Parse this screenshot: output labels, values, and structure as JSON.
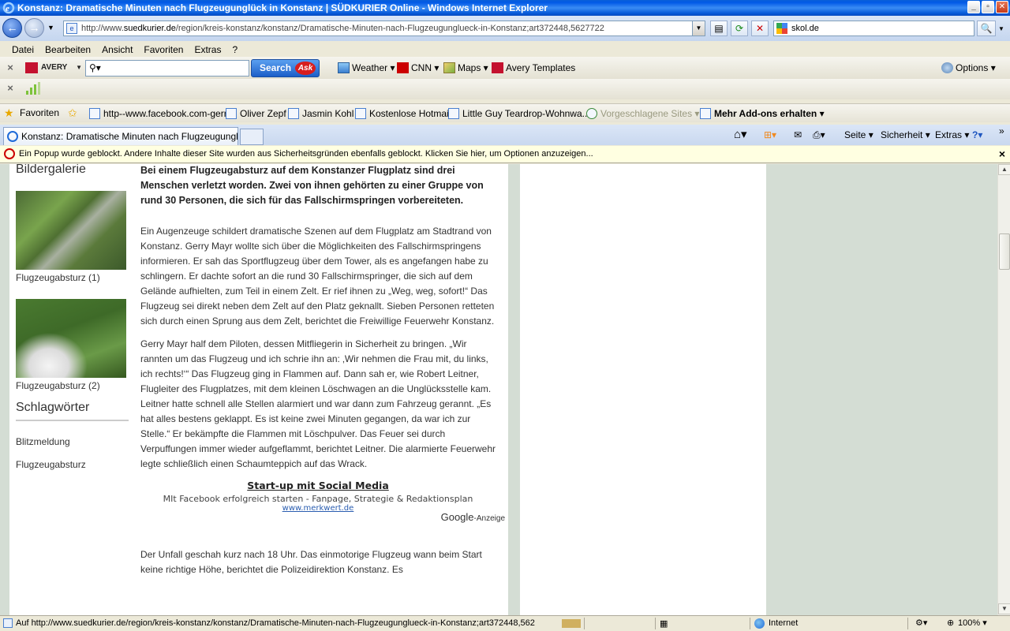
{
  "window": {
    "title": "Konstanz: Dramatische Minuten nach Flugzeugunglück in Konstanz | SÜDKURIER Online - Windows Internet Explorer",
    "min": "_",
    "max": "▫",
    "close": "✕"
  },
  "address": {
    "prefix": "http://www.",
    "host": "suedkurier.de",
    "path": "/region/kreis-konstanz/konstanz/Dramatische-Minuten-nach-Flugzeugunglueck-in-Konstanz;art372448,5627722",
    "search_value": "skol.de"
  },
  "menu": [
    "Datei",
    "Bearbeiten",
    "Ansicht",
    "Favoriten",
    "Extras",
    "?"
  ],
  "toolbar": {
    "avery_label": "AVERY",
    "search_label": "Search",
    "ask_logo": "Ask",
    "weather": "Weather",
    "cnn": "CNN",
    "maps": "Maps",
    "avery_templates": "Avery Templates",
    "options": "Options"
  },
  "favorites": {
    "label": "Favoriten",
    "items": [
      "http--www.facebook.com-gerry",
      "Oliver Zepf",
      "Jasmin Kohl",
      "Kostenlose Hotmail",
      "Little Guy Teardrop-Wohnwa...",
      "Vorgeschlagene Sites",
      "Mehr Add-ons erhalten"
    ]
  },
  "tabs": {
    "active_title": "Konstanz: Dramatische Minuten nach Flugzeugunglück...",
    "commands": [
      "Seite",
      "Sicherheit",
      "Extras"
    ]
  },
  "popup": {
    "message": "Ein Popup wurde geblockt. Andere Inhalte dieser Site wurden aus Sicherheitsgründen ebenfalls geblockt. Klicken Sie hier, um Optionen anzuzeigen..."
  },
  "sidebar": {
    "gallery_heading": "Bildergalerie",
    "gallery": [
      "Flugzeugabsturz (1)",
      "Flugzeugabsturz (2)"
    ],
    "tags_heading": "Schlagwörter",
    "tags": [
      "Blitzmeldung",
      "Flugzeugabsturz"
    ]
  },
  "article": {
    "lead": "Bei einem Flugzeugabsturz auf dem Konstanzer Flugplatz sind drei Menschen verletzt worden. Zwei von ihnen gehörten zu einer Gruppe von rund 30 Personen, die sich für das Fallschirmspringen vorbereiteten.",
    "p1": "Ein Augenzeuge schildert dramatische Szenen auf dem Flugplatz am Stadtrand von Konstanz. Gerry Mayr wollte sich über die Möglichkeiten des Fallschirmspringens informieren. Er sah das Sportflugzeug über dem Tower, als es angefangen habe zu schlingern. Er dachte sofort an die rund 30 Fallschirmspringer, die sich auf dem Gelände aufhielten, zum Teil in einem Zelt. Er rief ihnen zu „Weg, weg, sofort!“ Das Flugzeug sei direkt neben dem Zelt auf den Platz geknallt. Sieben Personen retteten sich durch einen Sprung aus dem Zelt, berichtet die Freiwillige Feuerwehr Konstanz.",
    "p2": "Gerry Mayr half dem Piloten, dessen Mitfliegerin in Sicherheit zu bringen. „Wir rannten um das Flugzeug und ich schrie ihn an: ‚Wir nehmen die Frau mit, du links, ich rechts!‘“ Das Flugzeug ging in Flammen auf. Dann sah er, wie Robert Leitner, Flugleiter des Flugplatzes, mit dem kleinen Löschwagen an die Unglücksstelle kam. Leitner hatte schnell alle Stellen alarmiert und war dann zum Fahrzeug gerannt. „Es hat alles bestens geklappt. Es ist keine zwei Minuten gegangen, da war ich zur Stelle.“ Er bekämpfte die Flammen mit Löschpulver. Das Feuer sei durch Verpuffungen immer wieder aufgeflammt, berichtet Leitner. Die alarmierte Feuerwehr legte schließlich einen Schaumteppich auf das Wrack.",
    "ad": {
      "title": "Start-up mit Social Media",
      "text": "MIt Facebook erfolgreich starten - Fanpage, Strategie & Redaktionsplan",
      "url": "www.merkwert.de",
      "google": "Google",
      "google_suffix": "-Anzeige"
    },
    "p3": "Der Unfall geschah kurz nach 18 Uhr. Das einmotorige Flugzeug wann beim Start keine richtige Höhe, berichtet die Polizeidirektion Konstanz. Es"
  },
  "status": {
    "text": "Auf http://www.suedkurier.de/region/kreis-konstanz/konstanz/Dramatische-Minuten-nach-Flugzeugunglueck-in-Konstanz;art372448,562",
    "zone": "Internet",
    "zoom": "100%"
  }
}
